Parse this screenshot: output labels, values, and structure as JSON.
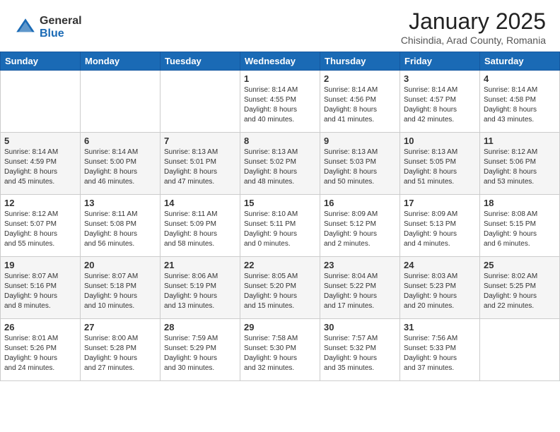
{
  "header": {
    "logo_general": "General",
    "logo_blue": "Blue",
    "month_title": "January 2025",
    "location": "Chisindia, Arad County, Romania"
  },
  "weekdays": [
    "Sunday",
    "Monday",
    "Tuesday",
    "Wednesday",
    "Thursday",
    "Friday",
    "Saturday"
  ],
  "weeks": [
    [
      {
        "day": "",
        "info": ""
      },
      {
        "day": "",
        "info": ""
      },
      {
        "day": "",
        "info": ""
      },
      {
        "day": "1",
        "info": "Sunrise: 8:14 AM\nSunset: 4:55 PM\nDaylight: 8 hours\nand 40 minutes."
      },
      {
        "day": "2",
        "info": "Sunrise: 8:14 AM\nSunset: 4:56 PM\nDaylight: 8 hours\nand 41 minutes."
      },
      {
        "day": "3",
        "info": "Sunrise: 8:14 AM\nSunset: 4:57 PM\nDaylight: 8 hours\nand 42 minutes."
      },
      {
        "day": "4",
        "info": "Sunrise: 8:14 AM\nSunset: 4:58 PM\nDaylight: 8 hours\nand 43 minutes."
      }
    ],
    [
      {
        "day": "5",
        "info": "Sunrise: 8:14 AM\nSunset: 4:59 PM\nDaylight: 8 hours\nand 45 minutes."
      },
      {
        "day": "6",
        "info": "Sunrise: 8:14 AM\nSunset: 5:00 PM\nDaylight: 8 hours\nand 46 minutes."
      },
      {
        "day": "7",
        "info": "Sunrise: 8:13 AM\nSunset: 5:01 PM\nDaylight: 8 hours\nand 47 minutes."
      },
      {
        "day": "8",
        "info": "Sunrise: 8:13 AM\nSunset: 5:02 PM\nDaylight: 8 hours\nand 48 minutes."
      },
      {
        "day": "9",
        "info": "Sunrise: 8:13 AM\nSunset: 5:03 PM\nDaylight: 8 hours\nand 50 minutes."
      },
      {
        "day": "10",
        "info": "Sunrise: 8:13 AM\nSunset: 5:05 PM\nDaylight: 8 hours\nand 51 minutes."
      },
      {
        "day": "11",
        "info": "Sunrise: 8:12 AM\nSunset: 5:06 PM\nDaylight: 8 hours\nand 53 minutes."
      }
    ],
    [
      {
        "day": "12",
        "info": "Sunrise: 8:12 AM\nSunset: 5:07 PM\nDaylight: 8 hours\nand 55 minutes."
      },
      {
        "day": "13",
        "info": "Sunrise: 8:11 AM\nSunset: 5:08 PM\nDaylight: 8 hours\nand 56 minutes."
      },
      {
        "day": "14",
        "info": "Sunrise: 8:11 AM\nSunset: 5:09 PM\nDaylight: 8 hours\nand 58 minutes."
      },
      {
        "day": "15",
        "info": "Sunrise: 8:10 AM\nSunset: 5:11 PM\nDaylight: 9 hours\nand 0 minutes."
      },
      {
        "day": "16",
        "info": "Sunrise: 8:09 AM\nSunset: 5:12 PM\nDaylight: 9 hours\nand 2 minutes."
      },
      {
        "day": "17",
        "info": "Sunrise: 8:09 AM\nSunset: 5:13 PM\nDaylight: 9 hours\nand 4 minutes."
      },
      {
        "day": "18",
        "info": "Sunrise: 8:08 AM\nSunset: 5:15 PM\nDaylight: 9 hours\nand 6 minutes."
      }
    ],
    [
      {
        "day": "19",
        "info": "Sunrise: 8:07 AM\nSunset: 5:16 PM\nDaylight: 9 hours\nand 8 minutes."
      },
      {
        "day": "20",
        "info": "Sunrise: 8:07 AM\nSunset: 5:18 PM\nDaylight: 9 hours\nand 10 minutes."
      },
      {
        "day": "21",
        "info": "Sunrise: 8:06 AM\nSunset: 5:19 PM\nDaylight: 9 hours\nand 13 minutes."
      },
      {
        "day": "22",
        "info": "Sunrise: 8:05 AM\nSunset: 5:20 PM\nDaylight: 9 hours\nand 15 minutes."
      },
      {
        "day": "23",
        "info": "Sunrise: 8:04 AM\nSunset: 5:22 PM\nDaylight: 9 hours\nand 17 minutes."
      },
      {
        "day": "24",
        "info": "Sunrise: 8:03 AM\nSunset: 5:23 PM\nDaylight: 9 hours\nand 20 minutes."
      },
      {
        "day": "25",
        "info": "Sunrise: 8:02 AM\nSunset: 5:25 PM\nDaylight: 9 hours\nand 22 minutes."
      }
    ],
    [
      {
        "day": "26",
        "info": "Sunrise: 8:01 AM\nSunset: 5:26 PM\nDaylight: 9 hours\nand 24 minutes."
      },
      {
        "day": "27",
        "info": "Sunrise: 8:00 AM\nSunset: 5:28 PM\nDaylight: 9 hours\nand 27 minutes."
      },
      {
        "day": "28",
        "info": "Sunrise: 7:59 AM\nSunset: 5:29 PM\nDaylight: 9 hours\nand 30 minutes."
      },
      {
        "day": "29",
        "info": "Sunrise: 7:58 AM\nSunset: 5:30 PM\nDaylight: 9 hours\nand 32 minutes."
      },
      {
        "day": "30",
        "info": "Sunrise: 7:57 AM\nSunset: 5:32 PM\nDaylight: 9 hours\nand 35 minutes."
      },
      {
        "day": "31",
        "info": "Sunrise: 7:56 AM\nSunset: 5:33 PM\nDaylight: 9 hours\nand 37 minutes."
      },
      {
        "day": "",
        "info": ""
      }
    ]
  ]
}
